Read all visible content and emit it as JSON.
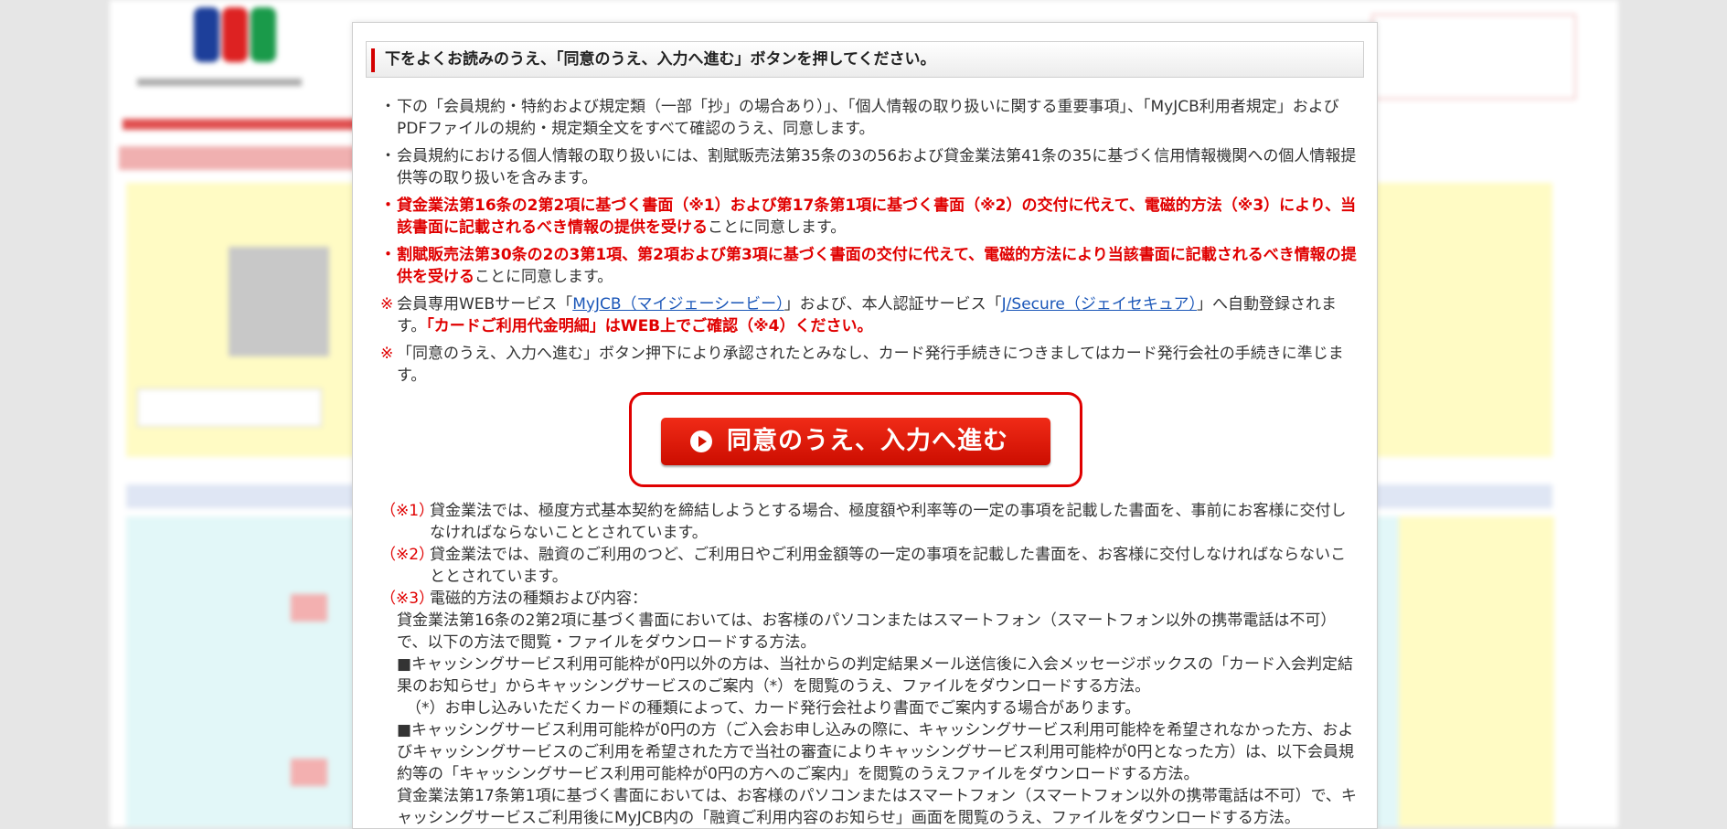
{
  "modal": {
    "title": "下をよくお読みのうえ、「同意のうえ、入力へ進む」ボタンを押してください。",
    "items": [
      {
        "mark": "・",
        "text": "下の「会員規約・特約および規定類（一部「抄」の場合あり）」、「個人情報の取り扱いに関する重要事項」、「MyJCB利用者規定」およびPDFファイルの規約・規定類全文をすべて確認のうえ、同意します。"
      },
      {
        "mark": "・",
        "text": "会員規約における個人情報の取り扱いには、割賦販売法第35条の3の56および貸金業法第41条の35に基づく信用情報機関への個人情報提供等の取り扱いを含みます。"
      },
      {
        "mark": "・",
        "bold": "貸金業法第16条の2第2項に基づく書面（※1）および第17条第1項に基づく書面（※2）の交付に代えて、電磁的方法（※3）により、当該書面に記載されるべき情報の提供を受ける",
        "rest": "ことに同意します。"
      },
      {
        "mark": "・",
        "bold": "割賦販売法第30条の2の3第1項、第2項および第3項に基づく書面の交付に代えて、電磁的方法により当該書面に記載されるべき情報の提供を受ける",
        "rest": "ことに同意します。"
      }
    ],
    "note1": {
      "mark": "※",
      "pre": "会員専用WEBサービス「",
      "link1": "MyJCB（マイジェーシービー）",
      "mid": "」および、本人認証サービス「",
      "link2": "J/Secure（ジェイセキュア）",
      "post": "」へ自動登録されます。",
      "bold": "「カードご利用代金明細」はWEB上でご確認（※4）ください。"
    },
    "note2": {
      "mark": "※",
      "text": "「同意のうえ、入力へ進む」ボタン押下により承認されたとみなし、カード発行手続きにつきましてはカード発行会社の手続きに準じます。"
    },
    "cta_label": "同意のうえ、入力へ進む",
    "fn1": {
      "mark": "（※1）",
      "text": "貸金業法では、極度方式基本契約を締結しようとする場合、極度額や利率等の一定の事項を記載した書面を、事前にお客様に交付しなければならないこととされています。"
    },
    "fn2": {
      "mark": "（※2）",
      "text": "貸金業法では、融資のご利用のつど、ご利用日やご利用金額等の一定の事項を記載した書面を、お客様に交付しなければならないこととされています。"
    },
    "fn3": {
      "mark": "（※3）",
      "text": "電磁的方法の種類および内容："
    },
    "fn3_lines": [
      "貸金業法第16条の2第2項に基づく書面においては、お客様のパソコンまたはスマートフォン（スマートフォン以外の携帯電話は不可）で、以下の方法で閲覧・ファイルをダウンロードする方法。",
      "■キャッシングサービス利用可能枠が0円以外の方は、当社からの判定結果メール送信後に入会メッセージボックスの「カード入会判定結果のお知らせ」からキャッシングサービスのご案内（*）を閲覧のうえ、ファイルをダウンロードする方法。",
      "（*）お申し込みいただくカードの種類によって、カード発行会社より書面でご案内する場合があります。",
      "■キャッシングサービス利用可能枠が0円の方（ご入会お申し込みの際に、キャッシングサービス利用可能枠を希望されなかった方、およびキャッシングサービスのご利用を希望された方で当社の審査によりキャッシングサービス利用可能枠が0円となった方）は、以下会員規約等の「キャッシングサービス利用可能枠が0円の方へのご案内」を閲覧のうえファイルをダウンロードする方法。",
      "貸金業法第17条第1項に基づく書面においては、お客様のパソコンまたはスマートフォン（スマートフォン以外の携帯電話は不可）で、キャッシングサービスご利用後にMyJCB内の「融資ご利用内容のお知らせ」画面を閲覧のうえ、ファイルをダウンロードする方法。"
    ]
  },
  "colors": {
    "accent": "#e00000",
    "link": "#1a56b8"
  }
}
